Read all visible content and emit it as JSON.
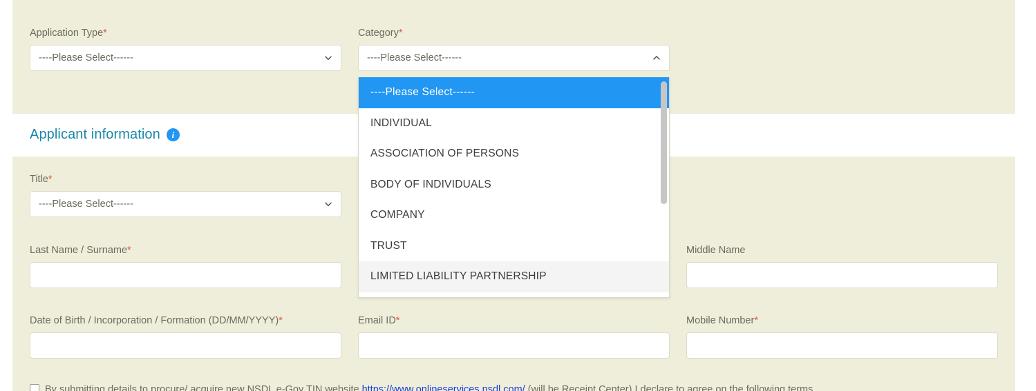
{
  "panels": {
    "top_bg": "#eeeedb",
    "bottom_bg": "#eeeedb"
  },
  "colors": {
    "panel_beige": "#eeeedb",
    "label_gray": "#6d6a5e",
    "required_red": "#e0583f",
    "heading_teal": "#1b87a8",
    "accent_blue": "#2196f3",
    "link_blue": "#1a3fd4",
    "field_border": "#dcdccb",
    "option_hover": "#f4f4f4",
    "scrollbar_thumb": "#c6c6c6"
  },
  "placeholder_select": "----Please Select------",
  "form": {
    "application_type": {
      "label": "Application Type",
      "required": true,
      "value": "----Please Select------",
      "chevron": "chevron-down-icon"
    },
    "category": {
      "label": "Category",
      "required": true,
      "value": "----Please Select------",
      "chevron": "chevron-up-icon",
      "expanded": true,
      "options": [
        "----Please Select------",
        "INDIVIDUAL",
        "ASSOCIATION OF PERSONS",
        "BODY OF INDIVIDUALS",
        "COMPANY",
        "TRUST",
        "LIMITED LIABILITY PARTNERSHIP"
      ],
      "selected_index": 0,
      "hovered_index": 6
    },
    "title": {
      "label": "Title",
      "required": true,
      "value": "----Please Select------",
      "chevron": "chevron-down-icon"
    },
    "last_name": {
      "label": "Last Name / Surname",
      "required": true,
      "value": "",
      "placeholder": ""
    },
    "middle_name": {
      "label": "Middle Name",
      "required": false,
      "value": "",
      "placeholder": ""
    },
    "date_of_birth": {
      "label": "Date of Birth / Incorporation / Formation (DD/MM/YYYY)",
      "required": true,
      "value": "",
      "placeholder": ""
    },
    "email_id": {
      "label": "Email ID",
      "required": true,
      "value": "",
      "placeholder": ""
    },
    "mobile_number": {
      "label": "Mobile Number",
      "required": true,
      "value": "",
      "placeholder": ""
    }
  },
  "section": {
    "applicant_information": {
      "title": "Applicant information",
      "info_icon": "info-circle-icon"
    }
  },
  "declaration": {
    "checked": false,
    "text_before": "By submitting details to procure/ acquire new NSDL e-Gov TIN website",
    "link_text": "https://www.onlineservices.nsdl.com/",
    "text_middle": "(will be Receipt Center)",
    "text_after": "I declare to agree on the following terms"
  }
}
